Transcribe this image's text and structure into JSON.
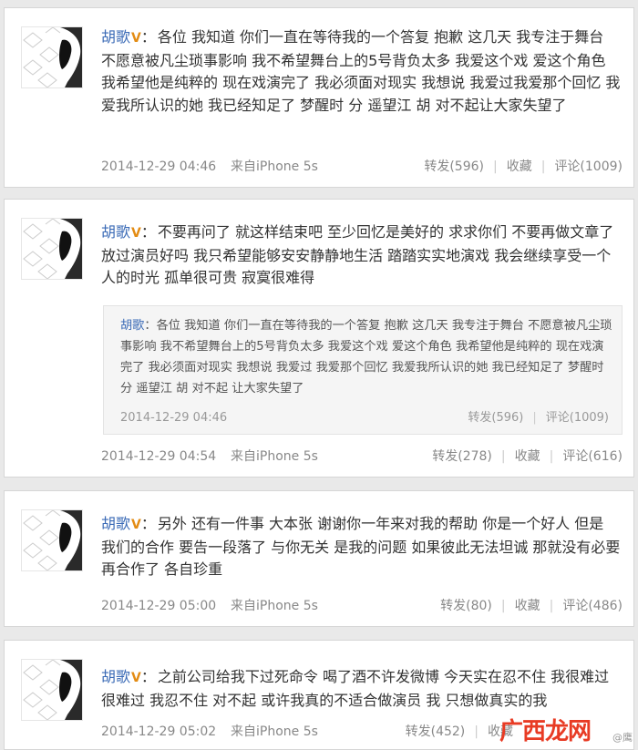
{
  "posts": [
    {
      "author": "胡歌",
      "badge": "V",
      "text": "各位 我知道 你们一直在等待我的一个答复 抱歉 这几天 我专注于舞台 不愿意被凡尘琐事影响 我不希望舞台上的5号背负太多 我爱这个戏 爱这个角色 我希望他是纯粹的 现在戏演完了 我必须面对现实 我想说 我爱过我爱那个回忆 我爱我所认识的她 我已经知足了 梦醒时 分 遥望江 胡 对不起让大家失望了",
      "time": "2014-12-29 04:46",
      "source": "来自iPhone 5s",
      "repost": "转发(596)",
      "favorite": "收藏",
      "comment": "评论(1009)"
    },
    {
      "author": "胡歌",
      "badge": "V",
      "text": "不要再问了 就这样结束吧 至少回忆是美好的 求求你们 不要再做文章了 放过演员好吗 我只希望能够安安静静地生活 踏踏实实地演戏 我会继续享受一个人的时光 孤单很可贵 寂寞很难得",
      "quote": {
        "author": "胡歌",
        "text": "各位 我知道 你们一直在等待我的一个答复 抱歉 这几天 我专注于舞台 不愿意被凡尘琐事影响 我不希望舞台上的5号背负太多 我爱这个戏 爱这个角色 我希望他是纯粹的 现在戏演完了 我必须面对现实 我想说 我爱过 我爱那个回忆 我爱我所认识的她 我已经知足了 梦醒时 分 遥望江 胡 对不起 让大家失望了",
        "time": "2014-12-29 04:46",
        "repost": "转发(596)",
        "comment": "评论(1009)"
      },
      "time": "2014-12-29 04:54",
      "source": "来自iPhone 5s",
      "repost": "转发(278)",
      "favorite": "收藏",
      "comment": "评论(616)"
    },
    {
      "author": "胡歌",
      "badge": "V",
      "text": "另外 还有一件事 大本张 谢谢你一年来对我的帮助 你是一个好人 但是 我们的合作 要告一段落了 与你无关 是我的问题 如果彼此无法坦诚 那就没有必要再合作了 各自珍重",
      "time": "2014-12-29 05:00",
      "source": "来自iPhone 5s",
      "repost": "转发(80)",
      "favorite": "收藏",
      "comment": "评论(486)"
    },
    {
      "author": "胡歌",
      "badge": "V",
      "text": "之前公司给我下过死命令 喝了酒不许发微博 今天实在忍不住 我很难过 很难过 我忍不住 对不起 或许我真的不适合做演员 我 只想做真实的我",
      "time": "2014-12-29 05:02",
      "source": "来自iPhone 5s",
      "repost": "转发(452)",
      "favorite": "收藏",
      "comment": ""
    }
  ],
  "watermark": {
    "site": "广西龙网",
    "small": "@鹰"
  }
}
